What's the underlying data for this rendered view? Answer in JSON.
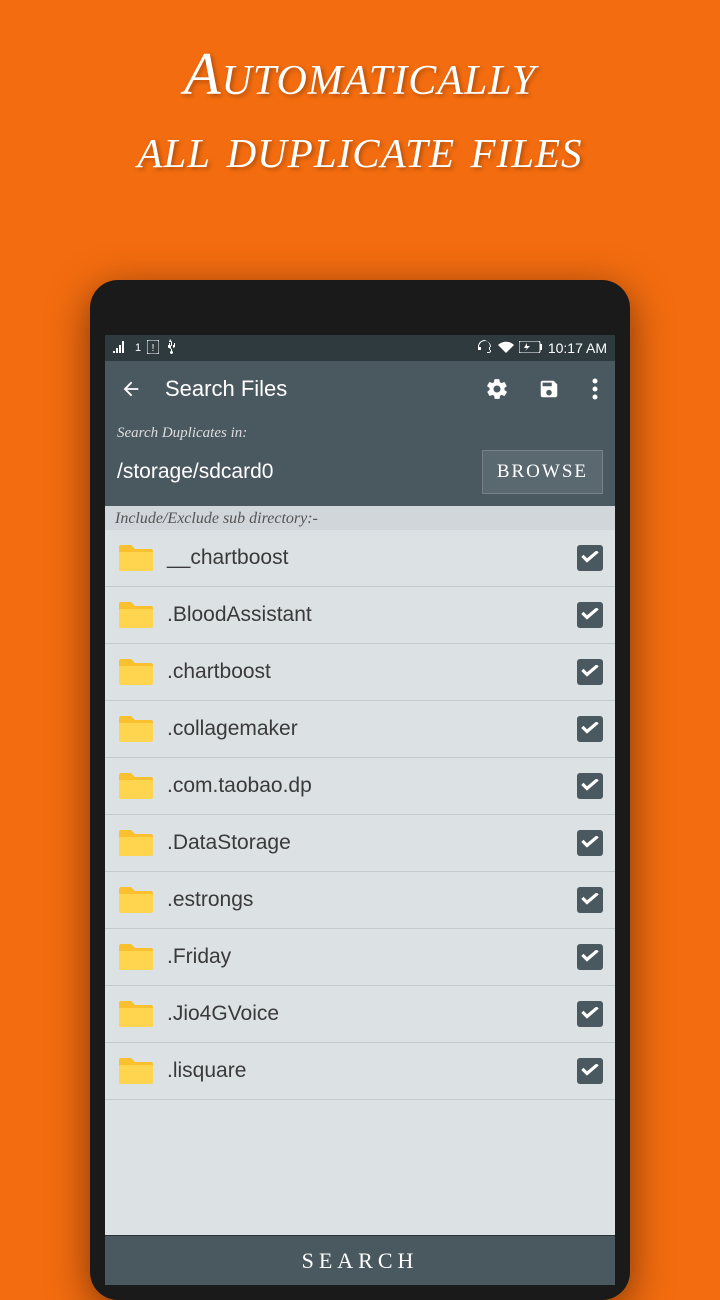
{
  "promo": {
    "line1": "Automatically",
    "line2": "all duplicate files"
  },
  "status": {
    "time": "10:17 AM"
  },
  "appbar": {
    "title": "Search Files"
  },
  "search": {
    "label": "Search Duplicates in:",
    "path": "/storage/sdcard0",
    "browse": "BROWSE"
  },
  "section_label": "Include/Exclude sub directory:-",
  "files": [
    {
      "name": "__chartboost",
      "checked": true
    },
    {
      "name": ".BloodAssistant",
      "checked": true
    },
    {
      "name": ".chartboost",
      "checked": true
    },
    {
      "name": ".collagemaker",
      "checked": true
    },
    {
      "name": ".com.taobao.dp",
      "checked": true
    },
    {
      "name": ".DataStorage",
      "checked": true
    },
    {
      "name": ".estrongs",
      "checked": true
    },
    {
      "name": ".Friday",
      "checked": true
    },
    {
      "name": ".Jio4GVoice",
      "checked": true
    },
    {
      "name": ".lisquare",
      "checked": true
    }
  ],
  "footer_button": "SEARCH"
}
